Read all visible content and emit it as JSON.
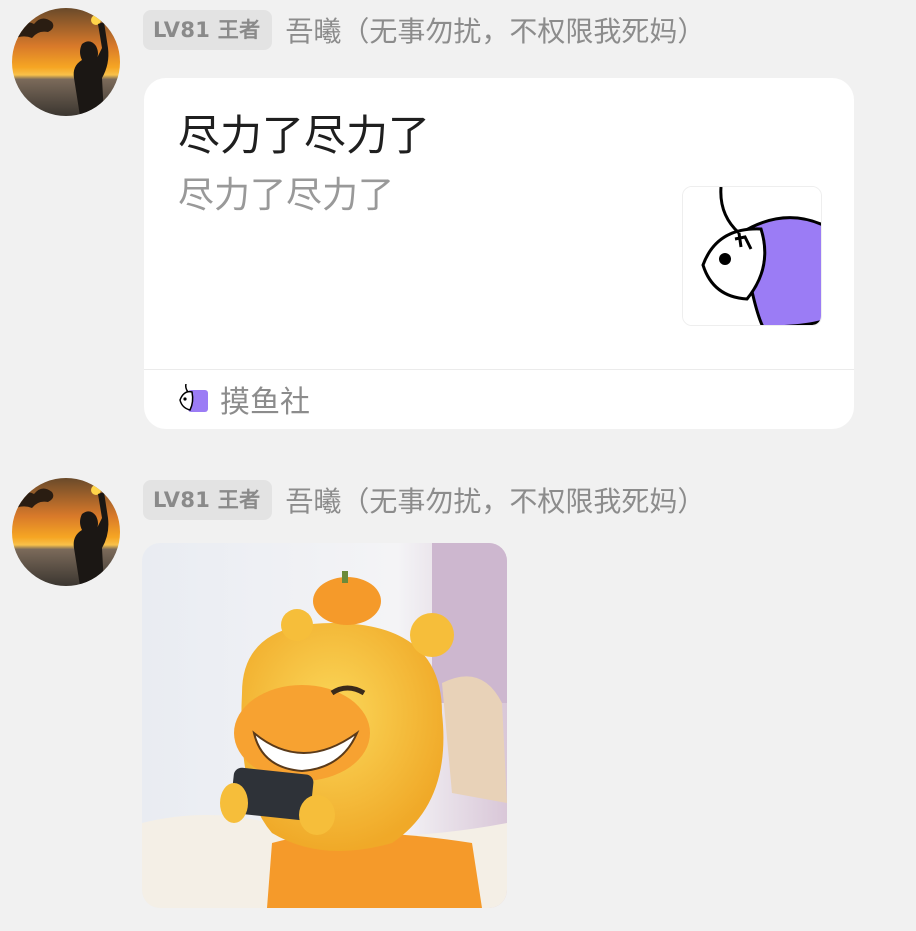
{
  "messages": [
    {
      "level_badge": "LV81 王者",
      "sender": "吾曦（无事勿扰，不权限我死妈）",
      "card": {
        "title": "尽力了尽力了",
        "description": "尽力了尽力了",
        "thumbnail_icon": "fish-icon",
        "source_label": "摸鱼社",
        "source_icon": "fish-icon"
      }
    },
    {
      "level_badge": "LV81 王者",
      "sender": "吾曦（无事勿扰，不权限我死妈）",
      "sticker": {
        "icon": "yellow-bear-gaming-sticker"
      }
    }
  ],
  "colors": {
    "background": "#f1f1f1",
    "card_background": "#ffffff",
    "fish_purple": "#9b7cf5",
    "sticker_yellow": "#f7c53f",
    "sticker_orange": "#f59a2a"
  }
}
